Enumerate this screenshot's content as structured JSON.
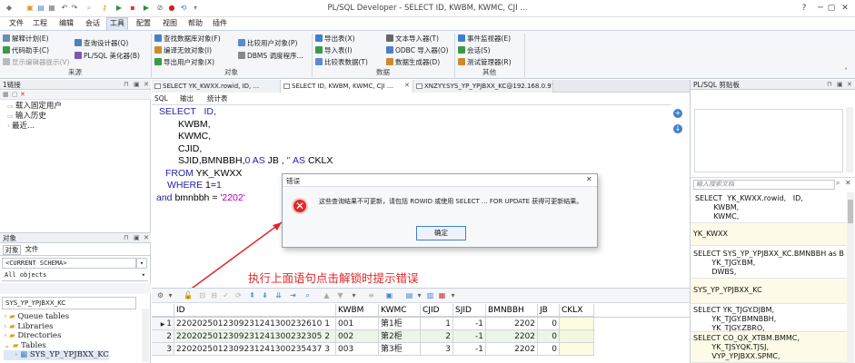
{
  "window": {
    "title": "PL/SQL Developer - SELECT ID, KWBM, KWMC, CJI ...",
    "controls": [
      "?",
      "─",
      "▢",
      "✕"
    ]
  },
  "menus": [
    "文件",
    "工程",
    "编辑",
    "会话",
    "工具",
    "配置",
    "视图",
    "帮助",
    "插件"
  ],
  "ribbon": {
    "groups": [
      "来源",
      "对象",
      "数据",
      "其他"
    ],
    "col1": [
      "解释计划(E)",
      "代码助手(C)",
      "显示编辑器提示(V)"
    ],
    "col1b": [
      "查询设计器(Q)",
      "PL/SQL 美化器(B)"
    ],
    "col2": [
      "查找数据库对象(F)",
      "编译无效对象(I)",
      "导出用户对象(X)"
    ],
    "col2b": [
      "比较用户对象(P)",
      "DBMS 调度程序..."
    ],
    "col3": [
      "导出表(X)",
      "导入表(I)",
      "比较表数据(T)"
    ],
    "col3b": [
      "文本导入器(T)",
      "ODBC 导入器(O)",
      "数据生成器(D)"
    ],
    "col4": [
      "事件监视器(E)",
      "会话(S)",
      "测试管理器(R)"
    ]
  },
  "left_top": {
    "title": "1链接",
    "items": [
      "载入固定用户",
      "输入历史",
      "最近..."
    ]
  },
  "left_bottom": {
    "title": "对象",
    "tabs": [
      "对象",
      "文件"
    ],
    "schema": "<CURRENT SCHEMA>",
    "filter": "All objects",
    "search": "SYS_YP_YPJBXX_KC",
    "tree": [
      "Queue tables",
      "Libraries",
      "Directories",
      "Tables",
      "SYS_YP_YPJBXX_KC"
    ]
  },
  "doc_tabs": [
    "SELECT YK_KWXX.rowid, ID, ...",
    "SELECT ID, KWBM, KWMC, CJI ...",
    "XNZYY.SYS_YP_YPJBXX_KC@192.168.0.97"
  ],
  "editor_tabs": [
    "SQL",
    "输出",
    "统计表"
  ],
  "sql": {
    "l1a": "SELECT",
    "l1b": "ID,",
    "l2": "KWBM,",
    "l3": "KWMC,",
    "l4": "CJID,",
    "l5a": "SJID,BMNBBH,",
    "l5b": "0",
    "l5c": "AS",
    "l5d": "JB ,",
    "l5e": "''",
    "l5f": "AS",
    "l5g": "CKLX",
    "l6a": "FROM",
    "l6b": "YK_KWXX",
    "l7a": "WHERE",
    "l7b": "1=",
    "l7c": "1",
    "l8a": "and",
    "l8b": "bmnbbh =",
    "l8c": "'2202'"
  },
  "dialog": {
    "title": "错误",
    "message": "这些查询结果不可更新，请包括 ROWID 或使用 SELECT ... FOR UPDATE 获得可更新结果。",
    "ok": "确定"
  },
  "annotation": "执行上面语句点击解锁时提示错误",
  "grid": {
    "columns": [
      "ID",
      "KWBM",
      "KWMC",
      "CJID",
      "SJID",
      "BMNBBH",
      "JB",
      "CKLX"
    ],
    "rows": [
      {
        "n": "1",
        "cells": [
          "2202025012309231241300232610 1",
          "001",
          "第1柜",
          "1",
          "-1",
          "2202",
          "0",
          ""
        ]
      },
      {
        "n": "2",
        "cells": [
          "2202025012309231241300232305 2",
          "002",
          "第2柜",
          "2",
          "-1",
          "2202",
          "0",
          ""
        ]
      },
      {
        "n": "3",
        "cells": [
          "2202025012309231241300235437 3",
          "003",
          "第3柜",
          "3",
          "-1",
          "2202",
          "0",
          ""
        ]
      }
    ]
  },
  "right_panel": {
    "title": "PL/SQL 剪贴板",
    "search_placeholder": "输入搜索文档",
    "items": [
      "SELECT  YK_KWXX.rowid,   ID,\n        KWBM,\n        KWMC,",
      "YK_KWXX",
      "SELECT SYS_YP_YPJBXX_KC.BMNBBH as B\n        YK_TJGY.BM,\n        DWBS,",
      "SYS_YP_YPJBXX_KC",
      "SELECT YK_TJGY.DJBM,\n        YK_TJGY.BMNBBH,\n        YK_TJGY.ZBRO,",
      "SELECT CO_QX_XTBM.BMMC,\n        YK_TJSYQK.TJSJ,\n        VYP_YPJBXX.SPMC,"
    ]
  },
  "colors": {
    "accent": "#2b5aa6",
    "error": "#d92b2b",
    "annotation": "#e0262a"
  }
}
